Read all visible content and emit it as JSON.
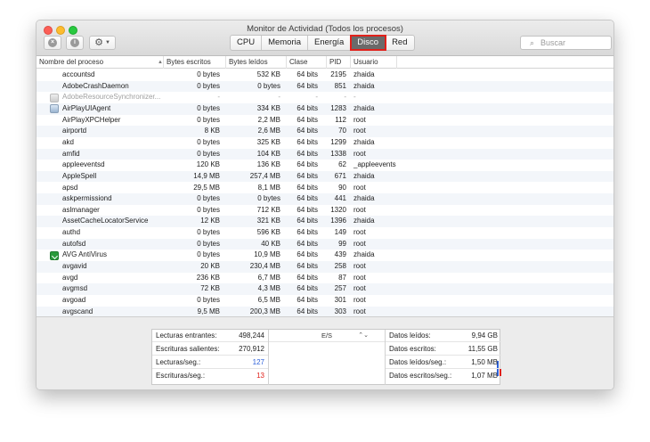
{
  "window": {
    "title": "Monitor de Actividad (Todos los procesos)"
  },
  "tabs": [
    {
      "label": "CPU",
      "active": false
    },
    {
      "label": "Memoria",
      "active": false
    },
    {
      "label": "Energía",
      "active": false
    },
    {
      "label": "Disco",
      "active": true
    },
    {
      "label": "Red",
      "active": false
    }
  ],
  "search": {
    "placeholder": "Buscar"
  },
  "icons": {
    "stop": "stop-process-icon",
    "info": "info-icon",
    "gear": "gear-icon",
    "search": "search-icon"
  },
  "columns": {
    "name": "Nombre del proceso",
    "written": "Bytes escritos",
    "read": "Bytes leídos",
    "kind": "Clase",
    "pid": "PID",
    "user": "Usuario"
  },
  "processes": [
    {
      "name": "accountsd",
      "written": "0 bytes",
      "read": "532 KB",
      "kind": "64 bits",
      "pid": "2195",
      "user": "zhaida",
      "icon": ""
    },
    {
      "name": "AdobeCrashDaemon",
      "written": "0 bytes",
      "read": "0 bytes",
      "kind": "64 bits",
      "pid": "851",
      "user": "zhaida",
      "icon": ""
    },
    {
      "name": "AdobeResourceSynchronizer...",
      "written": "-",
      "read": "-",
      "kind": "-",
      "pid": "-",
      "user": "-",
      "icon": "app-dim",
      "dim": true
    },
    {
      "name": "AirPlayUIAgent",
      "written": "0 bytes",
      "read": "334 KB",
      "kind": "64 bits",
      "pid": "1283",
      "user": "zhaida",
      "icon": "app"
    },
    {
      "name": "AirPlayXPCHelper",
      "written": "0 bytes",
      "read": "2,2 MB",
      "kind": "64 bits",
      "pid": "112",
      "user": "root",
      "icon": ""
    },
    {
      "name": "airportd",
      "written": "8 KB",
      "read": "2,6 MB",
      "kind": "64 bits",
      "pid": "70",
      "user": "root",
      "icon": ""
    },
    {
      "name": "akd",
      "written": "0 bytes",
      "read": "325 KB",
      "kind": "64 bits",
      "pid": "1299",
      "user": "zhaida",
      "icon": ""
    },
    {
      "name": "amfid",
      "written": "0 bytes",
      "read": "104 KB",
      "kind": "64 bits",
      "pid": "1338",
      "user": "root",
      "icon": ""
    },
    {
      "name": "appleeventsd",
      "written": "120 KB",
      "read": "136 KB",
      "kind": "64 bits",
      "pid": "62",
      "user": "_appleevents",
      "icon": ""
    },
    {
      "name": "AppleSpell",
      "written": "14,9 MB",
      "read": "257,4 MB",
      "kind": "64 bits",
      "pid": "671",
      "user": "zhaida",
      "icon": ""
    },
    {
      "name": "apsd",
      "written": "29,5 MB",
      "read": "8,1 MB",
      "kind": "64 bits",
      "pid": "90",
      "user": "root",
      "icon": ""
    },
    {
      "name": "askpermissiond",
      "written": "0 bytes",
      "read": "0 bytes",
      "kind": "64 bits",
      "pid": "441",
      "user": "zhaida",
      "icon": ""
    },
    {
      "name": "aslmanager",
      "written": "0 bytes",
      "read": "712 KB",
      "kind": "64 bits",
      "pid": "1320",
      "user": "root",
      "icon": ""
    },
    {
      "name": "AssetCacheLocatorService",
      "written": "12 KB",
      "read": "321 KB",
      "kind": "64 bits",
      "pid": "1396",
      "user": "zhaida",
      "icon": ""
    },
    {
      "name": "authd",
      "written": "0 bytes",
      "read": "596 KB",
      "kind": "64 bits",
      "pid": "149",
      "user": "root",
      "icon": ""
    },
    {
      "name": "autofsd",
      "written": "0 bytes",
      "read": "40 KB",
      "kind": "64 bits",
      "pid": "99",
      "user": "root",
      "icon": ""
    },
    {
      "name": "AVG AntiVirus",
      "written": "0 bytes",
      "read": "10,9 MB",
      "kind": "64 bits",
      "pid": "439",
      "user": "zhaida",
      "icon": "avg"
    },
    {
      "name": "avgavid",
      "written": "20 KB",
      "read": "230,4 MB",
      "kind": "64 bits",
      "pid": "258",
      "user": "root",
      "icon": ""
    },
    {
      "name": "avgd",
      "written": "236 KB",
      "read": "6,7 MB",
      "kind": "64 bits",
      "pid": "87",
      "user": "root",
      "icon": ""
    },
    {
      "name": "avgmsd",
      "written": "72 KB",
      "read": "4,3 MB",
      "kind": "64 bits",
      "pid": "257",
      "user": "root",
      "icon": ""
    },
    {
      "name": "avgoad",
      "written": "0 bytes",
      "read": "6,5 MB",
      "kind": "64 bits",
      "pid": "301",
      "user": "root",
      "icon": ""
    },
    {
      "name": "avgscand",
      "written": "9,5 MB",
      "read": "200,3 MB",
      "kind": "64 bits",
      "pid": "303",
      "user": "root",
      "icon": ""
    }
  ],
  "summary": {
    "left": [
      {
        "label": "Lecturas entrantes:",
        "value": "498,244",
        "color": "#222222"
      },
      {
        "label": "Escrituras salientes:",
        "value": "270,912",
        "color": "#222222"
      },
      {
        "label": "Lecturas/seg.:",
        "value": "127",
        "color": "#2b5fd9"
      },
      {
        "label": "Escrituras/seg.:",
        "value": "13",
        "color": "#e0201a"
      }
    ],
    "graph_label": "E/S",
    "right": [
      {
        "label": "Datos leídos:",
        "value": "9,94 GB"
      },
      {
        "label": "Datos escritos:",
        "value": "11,55 GB"
      },
      {
        "label": "Datos leídos/seg.:",
        "value": "1,50 MB"
      },
      {
        "label": "Datos escritos/seg.:",
        "value": "1,07 MB"
      }
    ]
  },
  "colors": {
    "active_tab_highlight": "#e0201a",
    "read_series": "#2b5fd9",
    "write_series": "#e0201a"
  }
}
